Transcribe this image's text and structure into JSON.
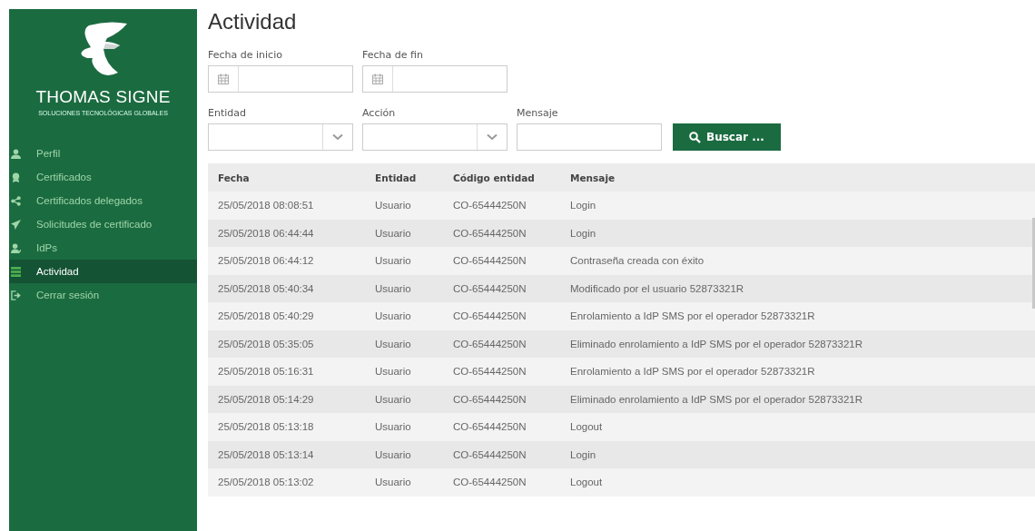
{
  "brand": {
    "name": "THOMAS SIGNE",
    "tagline": "SOLUCIONES TECNOLÓGICAS GLOBALES"
  },
  "sidebar": {
    "items": [
      {
        "label": "Perfil",
        "selected": false
      },
      {
        "label": "Certificados",
        "selected": false
      },
      {
        "label": "Certificados delegados",
        "selected": false
      },
      {
        "label": "Solicitudes de certificado",
        "selected": false
      },
      {
        "label": "IdPs",
        "selected": false
      },
      {
        "label": "Actividad",
        "selected": true
      },
      {
        "label": "Cerrar sesión",
        "selected": false
      }
    ]
  },
  "page": {
    "title": "Actividad"
  },
  "filters": {
    "dates": [
      {
        "label": "Fecha de inicio"
      },
      {
        "label": "Fecha de fin"
      }
    ],
    "selects": [
      {
        "label": "Entidad"
      },
      {
        "label": "Acción"
      }
    ],
    "message": {
      "label": "Mensaje"
    },
    "search_button": "Buscar ..."
  },
  "table": {
    "columns": [
      "Fecha",
      "Entidad",
      "Código entidad",
      "Mensaje"
    ],
    "rows": [
      [
        "25/05/2018 08:08:51",
        "Usuario",
        "CO-65444250N",
        "Login"
      ],
      [
        "25/05/2018 06:44:44",
        "Usuario",
        "CO-65444250N",
        "Login"
      ],
      [
        "25/05/2018 06:44:12",
        "Usuario",
        "CO-65444250N",
        "Contraseña creada con éxito"
      ],
      [
        "25/05/2018 05:40:34",
        "Usuario",
        "CO-65444250N",
        "Modificado por el usuario 52873321R"
      ],
      [
        "25/05/2018 05:40:29",
        "Usuario",
        "CO-65444250N",
        "Enrolamiento a IdP SMS por el operador 52873321R"
      ],
      [
        "25/05/2018 05:35:05",
        "Usuario",
        "CO-65444250N",
        "Eliminado enrolamiento a IdP SMS por el operador 52873321R"
      ],
      [
        "25/05/2018 05:16:31",
        "Usuario",
        "CO-65444250N",
        "Enrolamiento a IdP SMS por el operador 52873321R"
      ],
      [
        "25/05/2018 05:14:29",
        "Usuario",
        "CO-65444250N",
        "Eliminado enrolamiento a IdP SMS por el operador 52873321R"
      ],
      [
        "25/05/2018 05:13:18",
        "Usuario",
        "CO-65444250N",
        "Logout"
      ],
      [
        "25/05/2018 05:13:14",
        "Usuario",
        "CO-65444250N",
        "Login"
      ],
      [
        "25/05/2018 05:13:02",
        "Usuario",
        "CO-65444250N",
        "Logout"
      ]
    ]
  }
}
